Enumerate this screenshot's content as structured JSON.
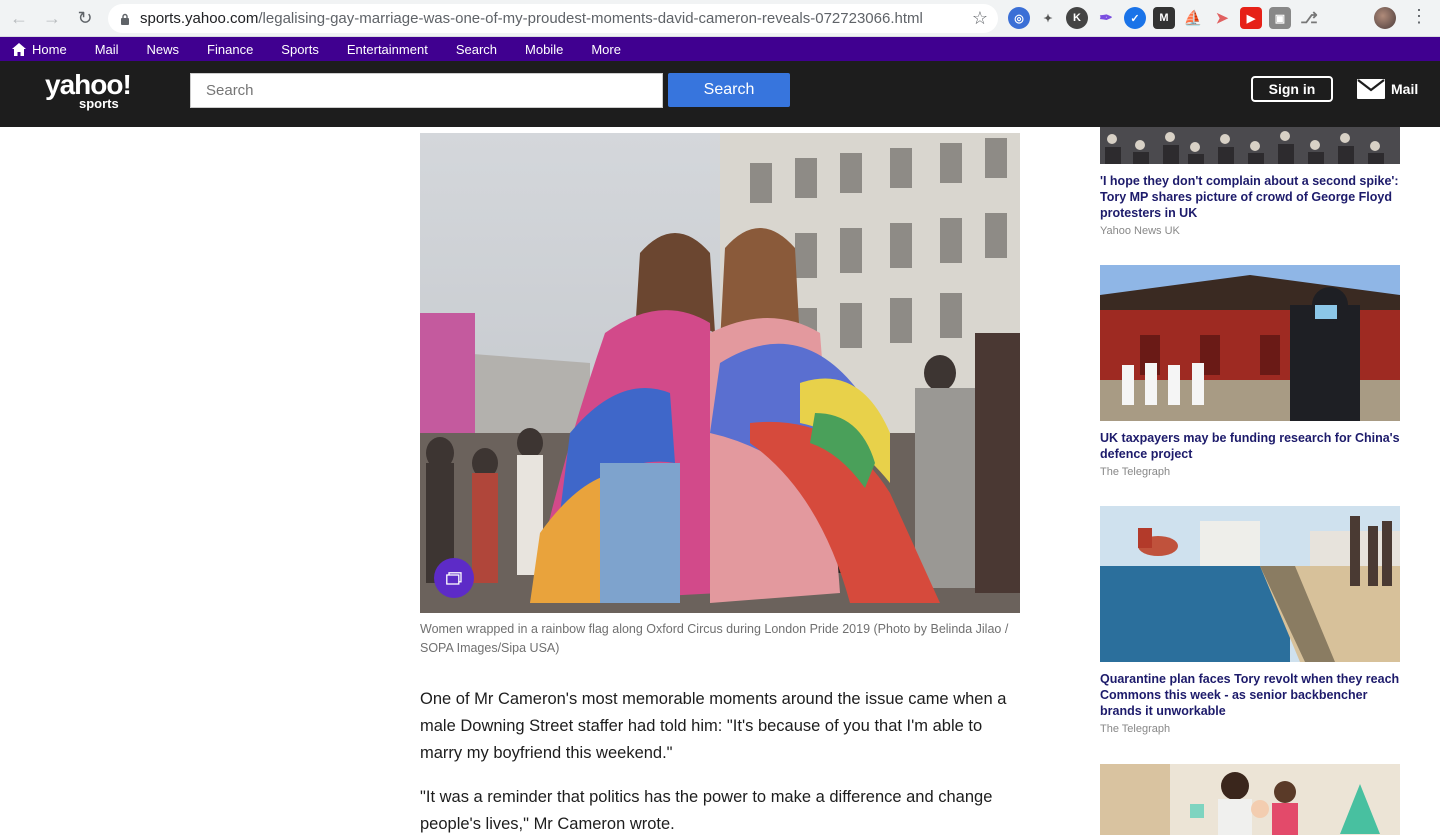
{
  "browser": {
    "url_host": "sports.yahoo.com",
    "url_path": "/legalising-gay-marriage-was-one-of-my-proudest-moments-david-cameron-reveals-072723066.html",
    "extension_icons": [
      "chrome-icon",
      "sparkle-icon",
      "k-icon",
      "pen-icon",
      "blue-circle-icon",
      "m-icon",
      "sail-icon",
      "arrow-icon",
      "youtube-icon",
      "photo-icon",
      "tag-icon"
    ]
  },
  "topnav": {
    "items": [
      "Home",
      "Mail",
      "News",
      "Finance",
      "Sports",
      "Entertainment",
      "Search",
      "Mobile",
      "More"
    ]
  },
  "header": {
    "logo_main": "yahoo!",
    "logo_sub": "sports",
    "search_placeholder": "Search",
    "search_button": "Search",
    "signin": "Sign in",
    "mail": "Mail"
  },
  "article": {
    "caption": "Women wrapped in a rainbow flag along Oxford Circus during London Pride 2019 (Photo by Belinda Jilao / SOPA Images/Sipa USA)",
    "paragraphs": [
      "One of Mr Cameron's most memorable moments around the issue came when a male Downing Street staffer had told him: \"It's because of you that I'm able to marry my boyfriend this weekend.\"",
      "\"It was a reminder that politics has the power to make a difference and change people's lives,\" Mr Cameron wrote."
    ]
  },
  "sidebar": {
    "stories": [
      {
        "title": "'I hope they don't complain about a second spike': Tory MP shares picture of crowd of George Floyd protesters in UK",
        "source": "Yahoo News UK"
      },
      {
        "title": "UK taxpayers may be funding research for China's defence project",
        "source": "The Telegraph"
      },
      {
        "title": "Quarantine plan faces Tory revolt when they reach Commons this week - as senior backbencher brands it unworkable",
        "source": "The Telegraph"
      }
    ]
  },
  "colors": {
    "yahoo_purple": "#400090",
    "header_bg": "#1d1d1d",
    "search_blue": "#3775dd",
    "headline_navy": "#1d1b6b"
  }
}
